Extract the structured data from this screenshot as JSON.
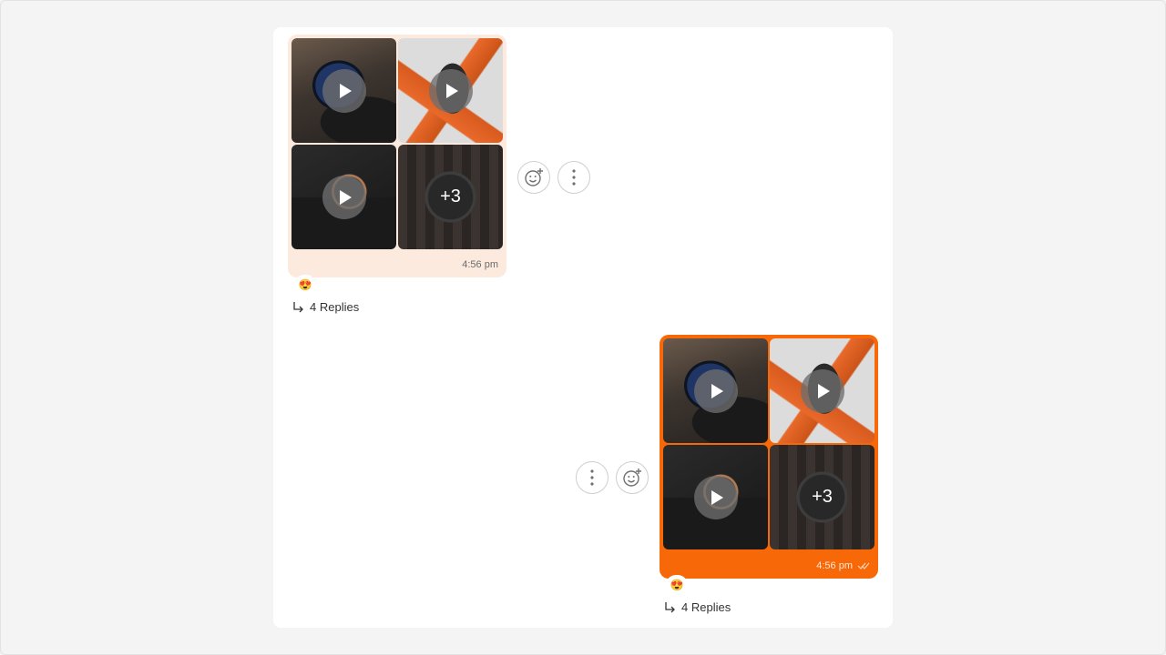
{
  "messages": [
    {
      "direction": "incoming",
      "media": [
        {
          "kind": "video",
          "subject": "blue smartwatch"
        },
        {
          "kind": "video",
          "subject": "orange band smartwatch"
        },
        {
          "kind": "video",
          "subject": "round rose-gold watch"
        },
        {
          "kind": "more",
          "subject": "steel chronograph watch",
          "overlay": "+3"
        }
      ],
      "time": "4:56 pm",
      "reaction": "😍",
      "replies_label": "4 Replies",
      "bubble_color": "#fdeadf"
    },
    {
      "direction": "outgoing",
      "media": [
        {
          "kind": "video",
          "subject": "blue smartwatch"
        },
        {
          "kind": "video",
          "subject": "orange band smartwatch"
        },
        {
          "kind": "video",
          "subject": "round rose-gold watch"
        },
        {
          "kind": "more",
          "subject": "steel chronograph watch",
          "overlay": "+3"
        }
      ],
      "time": "4:56 pm",
      "status_icon": "double-check-icon",
      "reaction": "😍",
      "replies_label": "4 Replies",
      "bubble_color": "#f76808"
    }
  ],
  "actions": {
    "react_icon": "add-reaction-icon",
    "more_icon": "more-vertical-icon"
  },
  "colors": {
    "accent": "#f76808",
    "incoming_bubble": "#fdeadf",
    "background": "#f4f4f4",
    "panel": "#ffffff"
  }
}
